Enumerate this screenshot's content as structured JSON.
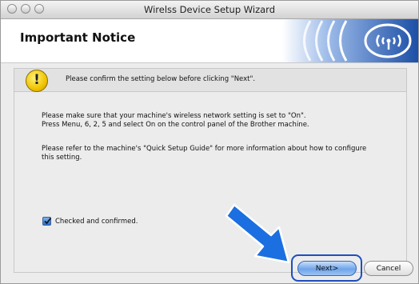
{
  "window": {
    "title": "Wirelss Device Setup Wizard"
  },
  "header": {
    "title": "Important Notice"
  },
  "notice": {
    "text": "Please confirm the setting below before clicking \"Next\"."
  },
  "body": {
    "para1_line1": "Please make sure that your machine's wireless network setting is set to \"On\".",
    "para1_line2": "Press Menu, 6, 2, 5 and select On on the control panel of the Brother machine.",
    "para2_line1": "Please refer to the machine's \"Quick Setup Guide\" for more information about how to configure",
    "para2_line2": "this setting."
  },
  "checkbox": {
    "label": "Checked and confirmed.",
    "checked": true
  },
  "buttons": {
    "next": "Next>",
    "cancel": "Cancel"
  },
  "colors": {
    "highlight": "#1e4fbf",
    "arrow": "#1b6fe0",
    "accent": "#2a5fb8"
  }
}
